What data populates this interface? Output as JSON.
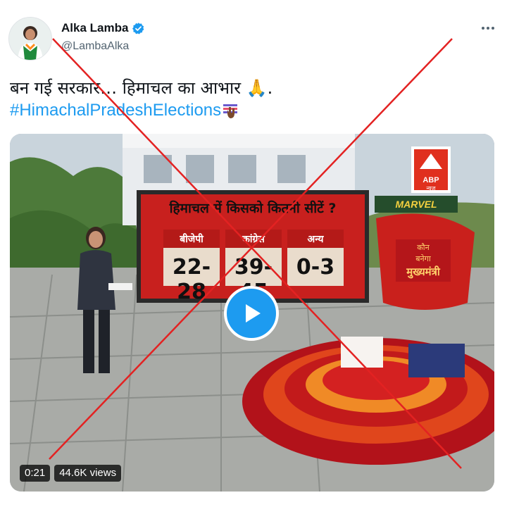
{
  "author": {
    "display_name": "Alka Lamba",
    "handle": "@LambaAlka",
    "verified": true,
    "avatar_icon": "profile-photo"
  },
  "more_icon": "more-horizontal-icon",
  "tweet": {
    "text": "बन गई सरकार… हिमाचल का आभार 🙏.",
    "hashtag": "#HimachalPradeshElections",
    "hashtag_emoji": "ballot-raised-hand-emoji"
  },
  "video": {
    "duration": "0:21",
    "views": "44.6K views",
    "play_icon": "play-icon",
    "board_title": "हिमाचल में किसको कितनी सीटें ?",
    "columns": [
      {
        "party": "बीजेपी",
        "seats": "22-28"
      },
      {
        "party": "कांग्रेस",
        "seats": "39-45"
      },
      {
        "party": "अन्य",
        "seats": "0-3"
      }
    ],
    "channel_logo": "ABP",
    "channel_sub": "न्यूज़",
    "sponsor": "MARVEL",
    "chair_text_1": "कौन",
    "chair_text_2": "बनेगा",
    "chair_text_3": "मुख्यमंत्री"
  },
  "colors": {
    "hashtag": "#1d9bf0",
    "handle": "#536471",
    "fact_check_cross": "#e32222",
    "board_red": "#c8201e"
  }
}
